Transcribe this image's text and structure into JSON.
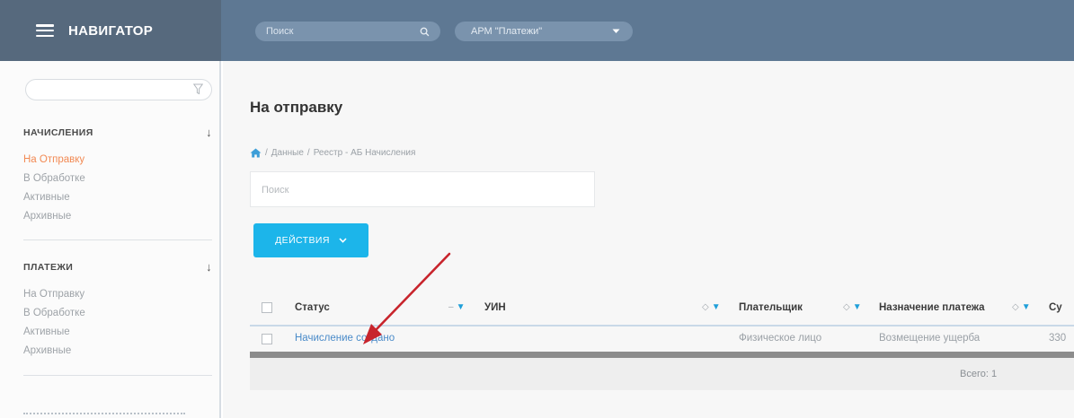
{
  "header": {
    "brand_title": "НАВИГАТОР",
    "search_placeholder": "Поиск",
    "apm_label": "АРМ \"Платежи\""
  },
  "sidebar": {
    "filter_value": "",
    "sections": [
      {
        "title": "НАЧИСЛЕНИЯ",
        "items": [
          {
            "label": "На Отправку",
            "active": true
          },
          {
            "label": "В Обработке"
          },
          {
            "label": "Активные"
          },
          {
            "label": "Архивные"
          }
        ]
      },
      {
        "title": "ПЛАТЕЖИ",
        "items": [
          {
            "label": "На Отправку"
          },
          {
            "label": "В Обработке"
          },
          {
            "label": "Активные"
          },
          {
            "label": "Архивные"
          }
        ]
      }
    ]
  },
  "main": {
    "title": "На отправку",
    "breadcrumb": [
      "Данные",
      "Реестр - АБ Начисления"
    ],
    "search_placeholder": "Поиск",
    "actions_label": "ДЕЙСТВИЯ"
  },
  "table": {
    "columns": [
      "Статус",
      "УИН",
      "Плательщик",
      "Назначение платежа",
      "Су"
    ],
    "rows": [
      {
        "status": "Начисление создано",
        "uin": "",
        "payer": "Физическое лицо",
        "purpose": "Возмещение ущерба",
        "amount": "330"
      }
    ],
    "total": "Всего: 1"
  },
  "colors": {
    "brand_bg": "#56697d",
    "topbar_bg": "#5e7893",
    "accent_button": "#1cb5ea",
    "active_nav": "#f28a54",
    "link": "#4a8bc9",
    "arrow": "#c8242c"
  },
  "icons": [
    "hamburger-icon",
    "search-icon",
    "chevron-down-icon",
    "filter-icon",
    "home-icon",
    "sort-icon",
    "arrow-down-icon"
  ]
}
